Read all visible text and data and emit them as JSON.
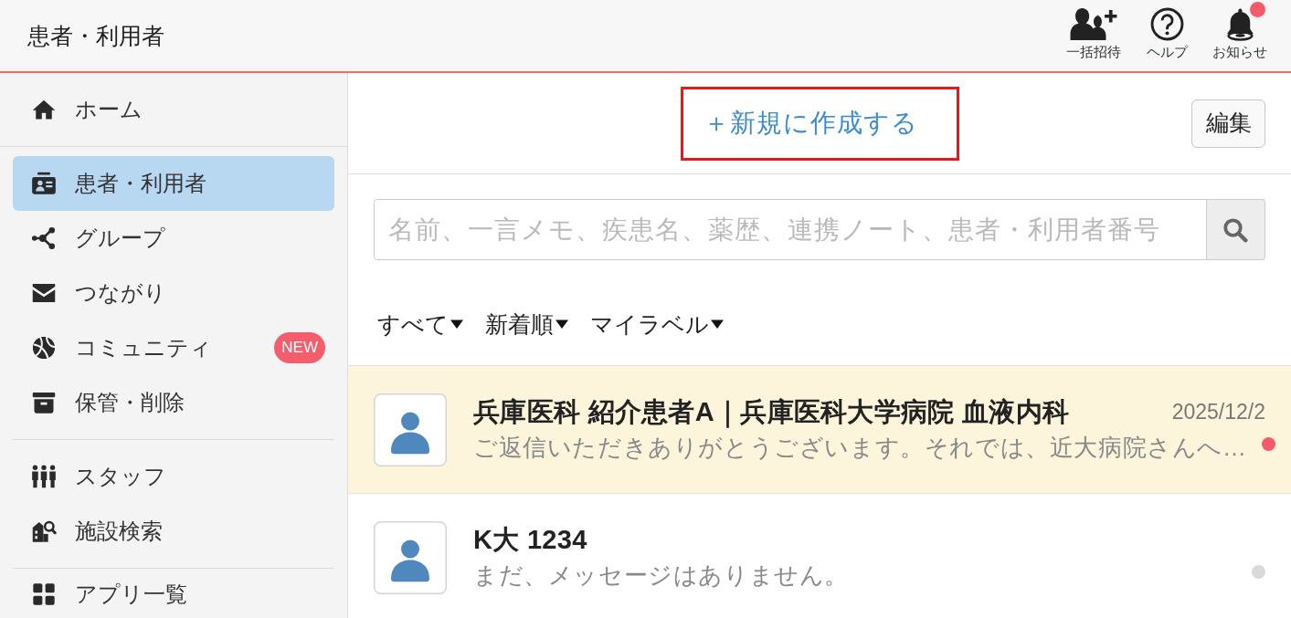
{
  "header": {
    "title": "患者・利用者",
    "actions": [
      {
        "kind": "invite",
        "label": "一括招待"
      },
      {
        "kind": "help",
        "label": "ヘルプ"
      },
      {
        "kind": "notifications",
        "label": "お知らせ",
        "unread": true
      }
    ]
  },
  "sidebar": {
    "sections": [
      {
        "items": [
          {
            "kind": "home",
            "label": "ホーム",
            "selected": false
          }
        ]
      },
      {
        "items": [
          {
            "kind": "patients",
            "label": "患者・利用者",
            "selected": true
          },
          {
            "kind": "groups",
            "label": "グループ",
            "selected": false
          },
          {
            "kind": "connections",
            "label": "つながり",
            "selected": false
          },
          {
            "kind": "community",
            "label": "コミュニティ",
            "selected": false,
            "badge": "NEW"
          },
          {
            "kind": "archive",
            "label": "保管・削除",
            "selected": false
          }
        ]
      },
      {
        "items": [
          {
            "kind": "staff",
            "label": "スタッフ",
            "selected": false
          },
          {
            "kind": "facility_search",
            "label": "施設検索",
            "selected": false
          }
        ]
      },
      {
        "items": [
          {
            "kind": "apps",
            "label": "アプリ一覧",
            "selected": false
          }
        ]
      }
    ]
  },
  "toolbar": {
    "create_link": {
      "label": "＋新規に作成する",
      "highlighted": true
    },
    "edit_button": "編集"
  },
  "search": {
    "placeholder": "名前、一言メモ、疾患名、薬歴、連携ノート、患者・利用者番号"
  },
  "filters": [
    "すべて",
    "新着順",
    "マイラベル"
  ],
  "conversations": [
    {
      "title": "兵庫医科 紹介患者A｜兵庫医科大学病院 血液内科",
      "date": "2025/12/2",
      "preview": "ご返信いただきありがとうございます。それでは、近大病院さんへ…",
      "highlighted": true,
      "unread": true
    },
    {
      "title": "K大 1234",
      "preview": "まだ、メッセージはありません。",
      "highlighted": false,
      "unread": false
    }
  ]
}
